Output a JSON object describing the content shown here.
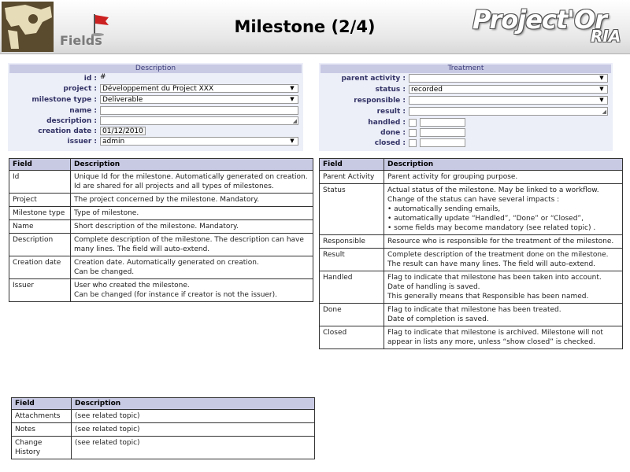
{
  "header": {
    "section_label": "Fields",
    "title": "Milestone (2/4)",
    "brand_main": "Project'Or",
    "brand_sub": "RIA"
  },
  "description_panel": {
    "title": "Description",
    "fields": [
      {
        "label": "id :",
        "value": "#",
        "kind": "text-only"
      },
      {
        "label": "project :",
        "value": "Développement du Project XXX",
        "kind": "select"
      },
      {
        "label": "milestone type :",
        "value": "Deliverable",
        "kind": "select"
      },
      {
        "label": "name :",
        "value": "",
        "kind": "input"
      },
      {
        "label": "description :",
        "value": "",
        "kind": "textarea"
      },
      {
        "label": "creation date :",
        "value": "01/12/2010",
        "kind": "date"
      },
      {
        "label": "issuer :",
        "value": "admin",
        "kind": "select"
      }
    ]
  },
  "treatment_panel": {
    "title": "Treatment",
    "fields": [
      {
        "label": "parent activity :",
        "value": "",
        "kind": "select"
      },
      {
        "label": "status :",
        "value": "recorded",
        "kind": "select"
      },
      {
        "label": "responsible :",
        "value": "",
        "kind": "select"
      },
      {
        "label": "result :",
        "value": "",
        "kind": "textarea"
      },
      {
        "label": "handled :",
        "value": "",
        "kind": "check-date"
      },
      {
        "label": "done :",
        "value": "",
        "kind": "check-date"
      },
      {
        "label": "closed :",
        "value": "",
        "kind": "check-date"
      }
    ]
  },
  "table_left": {
    "headers": [
      "Field",
      "Description"
    ],
    "rows": [
      {
        "field": "Id",
        "lines": [
          "Unique Id for the milestone. Automatically generated on creation.",
          "Id are shared for all projects and all types of milestones."
        ]
      },
      {
        "field": "Project",
        "lines": [
          "The project concerned by the milestone. Mandatory."
        ]
      },
      {
        "field": "Milestone type",
        "lines": [
          "Type of milestone."
        ]
      },
      {
        "field": "Name",
        "lines": [
          "Short description of the milestone. Mandatory."
        ]
      },
      {
        "field": "Description",
        "lines": [
          "Complete description of the milestone. The description can have many lines. The field will auto-extend."
        ]
      },
      {
        "field": "Creation date",
        "lines": [
          "Creation date. Automatically generated on creation.",
          "Can be changed."
        ]
      },
      {
        "field": "Issuer",
        "lines": [
          "User who created the milestone.",
          "Can be changed (for instance if creator is not the issuer)."
        ]
      }
    ]
  },
  "table_right": {
    "headers": [
      "Field",
      "Description"
    ],
    "rows": [
      {
        "field": "Parent Activity",
        "lines": [
          "Parent activity for grouping purpose."
        ]
      },
      {
        "field": "Status",
        "lines": [
          "Actual status of the milestone. May be linked to a workflow.",
          "Change of the status can have several impacts :",
          "• automatically sending emails,",
          "• automatically update “Handled”, “Done” or “Closed”,",
          "• some fields may become mandatory (see related topic) ."
        ]
      },
      {
        "field": "Responsible",
        "lines": [
          "Resource who is responsible for the treatment of the milestone."
        ]
      },
      {
        "field": "Result",
        "lines": [
          "Complete description of the treatment done on the milestone.",
          "The result can have many lines. The field will auto-extend."
        ]
      },
      {
        "field": "Handled",
        "lines": [
          "Flag to indicate that milestone has been taken into account.",
          "Date of handling is saved.",
          "This generally means that Responsible has been named."
        ]
      },
      {
        "field": "Done",
        "lines": [
          "Flag to indicate that milestone has been treated.",
          "Date of completion is saved."
        ]
      },
      {
        "field": "Closed",
        "lines": [
          "Flag to indicate that milestone is archived. Milestone will not appear in lists any more, unless “show closed” is checked."
        ]
      }
    ]
  },
  "table_bottom": {
    "headers": [
      "Field",
      "Description"
    ],
    "rows": [
      {
        "field": "Attachments",
        "lines": [
          "(see related topic)"
        ]
      },
      {
        "field": "Notes",
        "lines": [
          "(see related topic)"
        ]
      },
      {
        "field": "Change History",
        "lines": [
          "(see related topic)"
        ]
      }
    ]
  },
  "colors": {
    "panel_bg": "#eceef8",
    "panel_header": "#c8cae4",
    "label_text": "#333366"
  }
}
